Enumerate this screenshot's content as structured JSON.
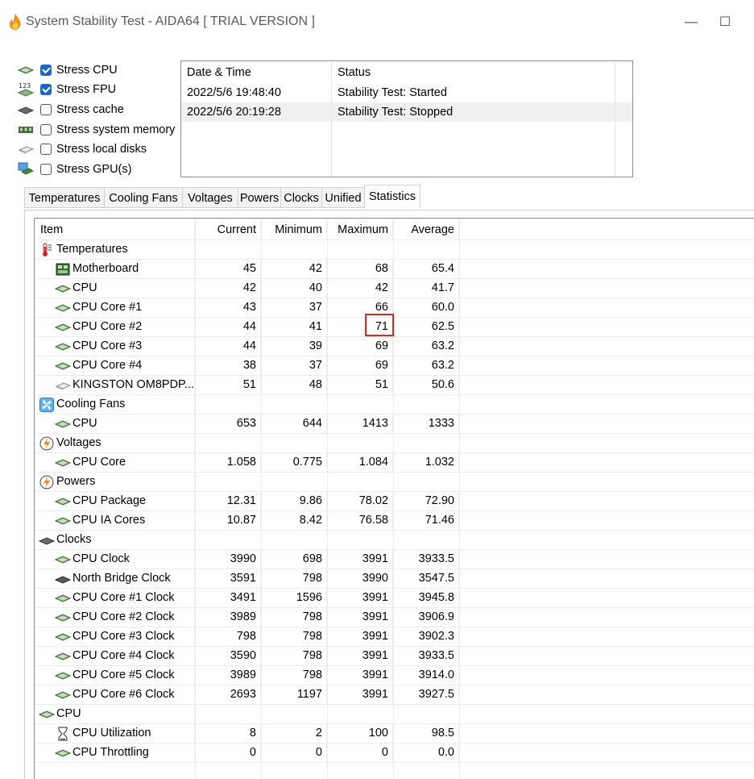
{
  "window": {
    "title": "System Stability Test - AIDA64  [ TRIAL VERSION ]",
    "minimize_glyph": "—",
    "maximize_glyph": "☐"
  },
  "stress_options": [
    {
      "label": "Stress CPU",
      "checked": true,
      "icon": "cpu-chip-icon"
    },
    {
      "label": "Stress FPU",
      "checked": true,
      "icon": "fpu-icon"
    },
    {
      "label": "Stress cache",
      "checked": false,
      "icon": "cache-icon"
    },
    {
      "label": "Stress system memory",
      "checked": false,
      "icon": "memory-icon"
    },
    {
      "label": "Stress local disks",
      "checked": false,
      "icon": "disk-icon"
    },
    {
      "label": "Stress GPU(s)",
      "checked": false,
      "icon": "gpu-icon"
    }
  ],
  "fpu_icon_text": "123",
  "log": {
    "headers": [
      "Date & Time",
      "Status"
    ],
    "rows": [
      [
        "2022/5/6 19:48:40",
        "Stability Test: Started"
      ],
      [
        "2022/5/6 20:19:28",
        "Stability Test: Stopped"
      ]
    ]
  },
  "tabs": [
    "Temperatures",
    "Cooling Fans",
    "Voltages",
    "Powers",
    "Clocks",
    "Unified",
    "Statistics"
  ],
  "active_tab": "Statistics",
  "stats": {
    "headers": [
      "Item",
      "Current",
      "Minimum",
      "Maximum",
      "Average"
    ],
    "rows": [
      {
        "group": true,
        "label": "Temperatures",
        "icon": "thermometer-icon"
      },
      {
        "label": "Motherboard",
        "icon": "motherboard-icon",
        "cur": "45",
        "min": "42",
        "max": "68",
        "avg": "65.4"
      },
      {
        "label": "CPU",
        "icon": "cpu-chip-icon",
        "cur": "42",
        "min": "40",
        "max": "42",
        "avg": "41.7"
      },
      {
        "label": "CPU Core #1",
        "icon": "cpu-chip-icon",
        "cur": "43",
        "min": "37",
        "max": "66",
        "avg": "60.0"
      },
      {
        "label": "CPU Core #2",
        "icon": "cpu-chip-icon",
        "cur": "44",
        "min": "41",
        "max": "71",
        "avg": "62.5"
      },
      {
        "label": "CPU Core #3",
        "icon": "cpu-chip-icon",
        "cur": "44",
        "min": "39",
        "max": "69",
        "avg": "63.2"
      },
      {
        "label": "CPU Core #4",
        "icon": "cpu-chip-icon",
        "cur": "38",
        "min": "37",
        "max": "69",
        "avg": "63.2"
      },
      {
        "label": "KINGSTON OM8PDP...",
        "icon": "disk-icon",
        "cur": "51",
        "min": "48",
        "max": "51",
        "avg": "50.6",
        "indent2": true
      },
      {
        "group": true,
        "label": "Cooling Fans",
        "icon": "fan-icon"
      },
      {
        "label": "CPU",
        "icon": "cpu-chip-icon",
        "cur": "653",
        "min": "644",
        "max": "1413",
        "avg": "1333"
      },
      {
        "group": true,
        "label": "Voltages",
        "icon": "lightning-icon"
      },
      {
        "label": "CPU Core",
        "icon": "cpu-chip-icon",
        "cur": "1.058",
        "min": "0.775",
        "max": "1.084",
        "avg": "1.032"
      },
      {
        "group": true,
        "label": "Powers",
        "icon": "lightning-icon"
      },
      {
        "label": "CPU Package",
        "icon": "cpu-chip-icon",
        "cur": "12.31",
        "min": "9.86",
        "max": "78.02",
        "avg": "72.90"
      },
      {
        "label": "CPU IA Cores",
        "icon": "cpu-chip-icon",
        "cur": "10.87",
        "min": "8.42",
        "max": "76.58",
        "avg": "71.46"
      },
      {
        "group": true,
        "label": "Clocks",
        "icon": "clock-chip-icon"
      },
      {
        "label": "CPU Clock",
        "icon": "cpu-chip-icon",
        "cur": "3990",
        "min": "698",
        "max": "3991",
        "avg": "3933.5"
      },
      {
        "label": "North Bridge Clock",
        "icon": "chip-dark-icon",
        "cur": "3591",
        "min": "798",
        "max": "3990",
        "avg": "3547.5"
      },
      {
        "label": "CPU Core #1 Clock",
        "icon": "cpu-chip-icon",
        "cur": "3491",
        "min": "1596",
        "max": "3991",
        "avg": "3945.8"
      },
      {
        "label": "CPU Core #2 Clock",
        "icon": "cpu-chip-icon",
        "cur": "3989",
        "min": "798",
        "max": "3991",
        "avg": "3906.9"
      },
      {
        "label": "CPU Core #3 Clock",
        "icon": "cpu-chip-icon",
        "cur": "798",
        "min": "798",
        "max": "3991",
        "avg": "3902.3"
      },
      {
        "label": "CPU Core #4 Clock",
        "icon": "cpu-chip-icon",
        "cur": "3590",
        "min": "798",
        "max": "3991",
        "avg": "3933.5"
      },
      {
        "label": "CPU Core #5 Clock",
        "icon": "cpu-chip-icon",
        "cur": "3989",
        "min": "798",
        "max": "3991",
        "avg": "3914.0"
      },
      {
        "label": "CPU Core #6 Clock",
        "icon": "cpu-chip-icon",
        "cur": "2693",
        "min": "1197",
        "max": "3991",
        "avg": "3927.5"
      },
      {
        "group": true,
        "label": "CPU",
        "icon": "cpu-chip-icon"
      },
      {
        "label": "CPU Utilization",
        "icon": "hourglass-icon",
        "cur": "8",
        "min": "2",
        "max": "100",
        "avg": "98.5"
      },
      {
        "label": "CPU Throttling",
        "icon": "cpu-chip-icon",
        "cur": "0",
        "min": "0",
        "max": "0",
        "avg": "0.0"
      }
    ]
  },
  "colors": {
    "highlight_box": "#d42a2a",
    "checkbox_on": "#1a67c4"
  }
}
